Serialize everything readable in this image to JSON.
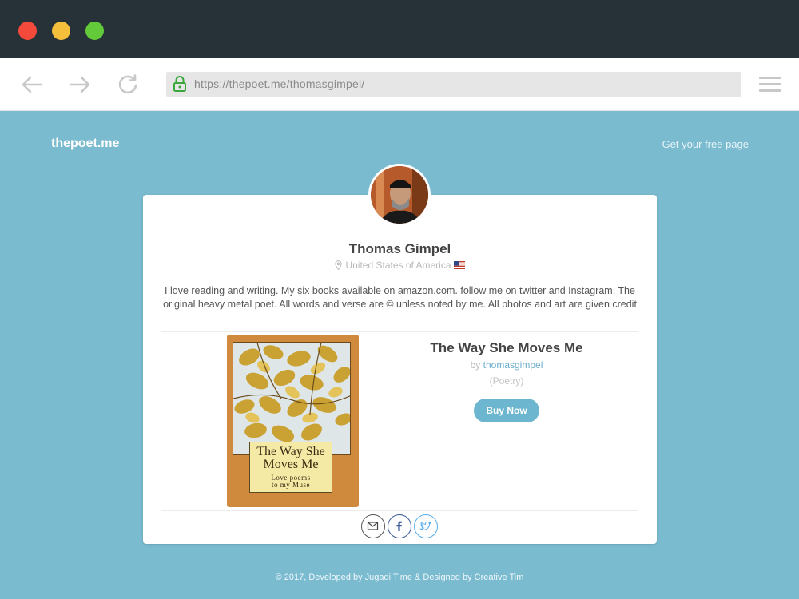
{
  "browser": {
    "url": "https://thepoet.me/thomasgimpel/"
  },
  "nav": {
    "brand": "thepoet.me",
    "cta_link": "Get your free page"
  },
  "profile": {
    "name": "Thomas Gimpel",
    "location": "United States of America",
    "bio": "I love reading and writing. My six books available on amazon.com. follow me on twitter and Instagram. The original heavy metal poet. All words and verse are © unless noted by me. All photos and art are given credit"
  },
  "book": {
    "title": "The Way She Moves Me",
    "by_prefix": "by",
    "author": "thomasgimpel",
    "genre": "(Poetry)",
    "buy_label": "Buy Now",
    "cover_title": "The Way She Moves Me",
    "cover_subtitle_line1": "Love poems",
    "cover_subtitle_line2": "to my Muse"
  },
  "icons": {
    "back": "arrow-left-icon",
    "forward": "arrow-right-icon",
    "reload": "reload-icon",
    "lock": "lock-icon",
    "menu": "hamburger-menu-icon",
    "location": "map-pin-icon",
    "flag": "us-flag-icon",
    "mail": "envelope-icon",
    "facebook": "facebook-icon",
    "twitter": "twitter-icon"
  },
  "colors": {
    "page_background": "#7abbd0",
    "titlebar": "#263238",
    "accent": "#6cb6cf",
    "window_close": "#f34a3b",
    "window_minimize": "#f5be3b",
    "window_maximize": "#63cb3a"
  },
  "footer": {
    "text": "© 2017, Developed by Jugadi Time & Designed by Creative Tim"
  }
}
